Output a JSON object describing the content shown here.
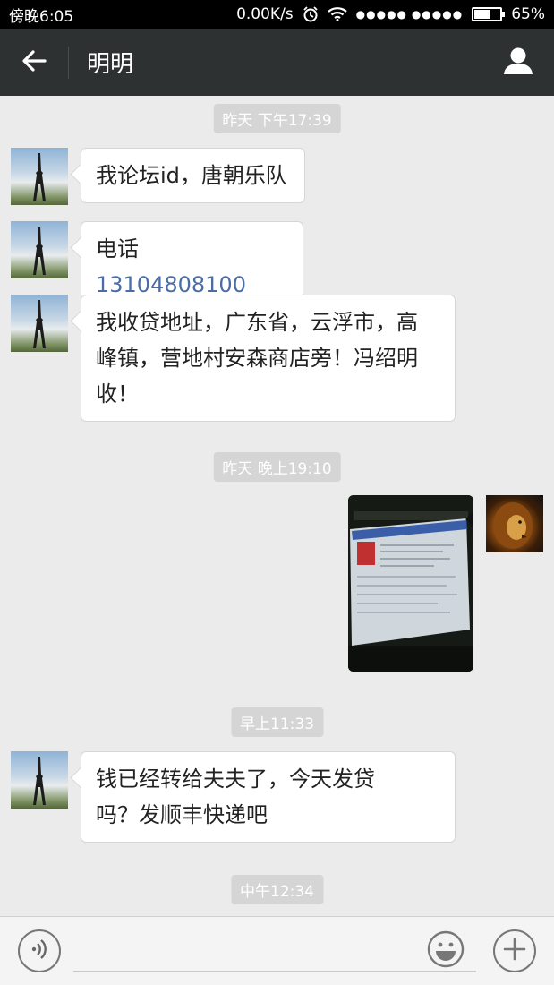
{
  "status_bar": {
    "time": "傍晚6:05",
    "network_speed": "0.00K/s",
    "signal_dots": "●●●●● ●●●●●",
    "battery_percent": "65%",
    "battery_level": 0.65,
    "icons": [
      "alarm-icon",
      "wifi-icon",
      "battery-icon"
    ]
  },
  "header": {
    "back_icon": "arrow-left-icon",
    "title": "明明",
    "profile_icon": "person-icon"
  },
  "chat": {
    "timestamps": [
      "昨天 下午17:39",
      "昨天 晚上19:10",
      "早上11:33",
      "中午12:34"
    ],
    "messages": [
      {
        "sender": "contact",
        "text": "我论坛id，唐朝乐队"
      },
      {
        "sender": "contact",
        "prefix": "电话",
        "phone": "13104808100"
      },
      {
        "sender": "contact",
        "lines": [
          "我收贷地址，广东省，云浮市，高",
          "峰镇，营地村安森商店旁！冯绍明",
          "收！"
        ]
      },
      {
        "sender": "me",
        "type": "image"
      },
      {
        "sender": "contact",
        "lines": [
          "钱已经转给夫夫了，今天发贷",
          "吗？发顺丰快递吧"
        ]
      }
    ]
  },
  "input_bar": {
    "voice_icon": "voice-icon",
    "emoji_icon": "emoji-icon",
    "plus_icon": "plus-icon"
  }
}
